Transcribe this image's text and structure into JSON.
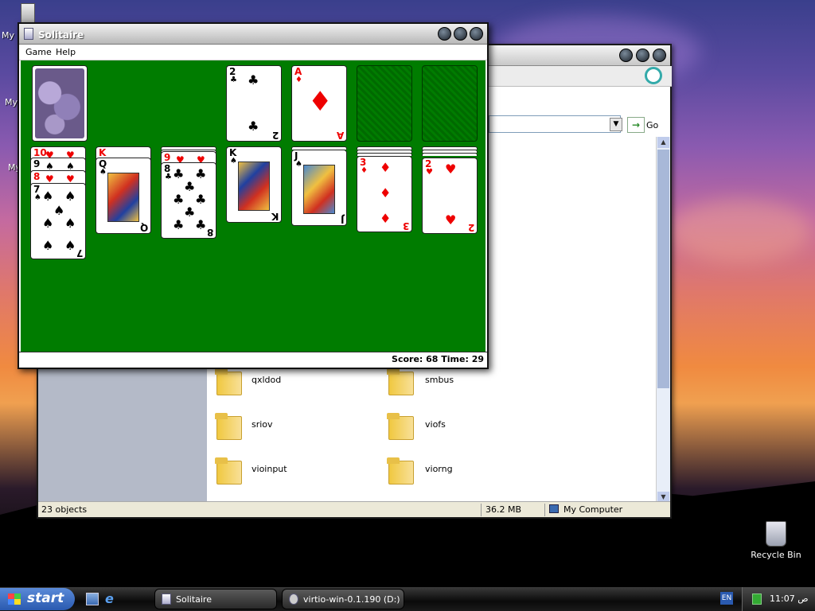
{
  "desktop": {
    "recycle_label": "Recycle Bin",
    "left_labels": [
      "My",
      "My",
      "My"
    ]
  },
  "explorer": {
    "go_label": "Go",
    "folders": [
      {
        "name": "qxldod"
      },
      {
        "name": "smbus"
      },
      {
        "name": "sriov"
      },
      {
        "name": "viofs"
      },
      {
        "name": "vioinput"
      },
      {
        "name": "viorng"
      }
    ],
    "status": {
      "objects": "23 objects",
      "size": "36.2 MB",
      "location": "My Computer"
    }
  },
  "solitaire": {
    "title": "Solitaire",
    "menu": [
      "Game",
      "Help"
    ],
    "score_text": "Score: 68  Time: 29",
    "stock": "card-back",
    "foundation_cards": [
      {
        "rank": "2",
        "suit": "♣",
        "color": "blk"
      },
      {
        "rank": "A",
        "suit": "♦",
        "color": "red"
      }
    ],
    "tableau": [
      {
        "stack": [
          {
            "rank": "10",
            "suit": "♥",
            "color": "red"
          },
          {
            "rank": "9",
            "suit": "♠",
            "color": "blk"
          },
          {
            "rank": "8",
            "suit": "♥",
            "color": "red"
          }
        ],
        "top": {
          "rank": "7",
          "suit": "♠",
          "color": "blk"
        }
      },
      {
        "stack": [
          {
            "rank": "K",
            "suit": "♥",
            "color": "red"
          }
        ],
        "top": {
          "rank": "Q",
          "suit": "♠",
          "color": "blk"
        }
      },
      {
        "stack": [
          {
            "rank": "9",
            "suit": "♥",
            "color": "red"
          }
        ],
        "top": {
          "rank": "8",
          "suit": "♣",
          "color": "blk"
        }
      },
      {
        "stack": [],
        "top": {
          "rank": "K",
          "suit": "♠",
          "color": "blk"
        }
      },
      {
        "stack": [],
        "top": {
          "rank": "J",
          "suit": "♠",
          "color": "blk"
        }
      },
      {
        "stack": [],
        "top": {
          "rank": "3",
          "suit": "♦",
          "color": "red"
        }
      },
      {
        "stack": [],
        "top": {
          "rank": "2",
          "suit": "♥",
          "color": "red"
        }
      }
    ]
  },
  "taskbar": {
    "start_label": "start",
    "buttons": [
      {
        "label": "Solitaire"
      },
      {
        "label": "virtio-win-0.1.190 (D:)"
      }
    ],
    "lang": "EN",
    "clock": "11:07 ص"
  }
}
